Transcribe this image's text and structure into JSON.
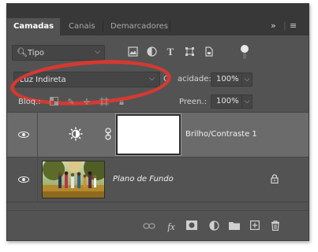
{
  "tabs": [
    {
      "label": "Camadas",
      "active": true
    },
    {
      "label": "Canais",
      "active": false
    },
    {
      "label": "Demarcadores",
      "active": false
    }
  ],
  "tabbar_controls": {
    "collapse": "»",
    "menu": "≡"
  },
  "filter": {
    "icon": "search-icon",
    "value": "Tipo"
  },
  "filter_icons": [
    "image-icon",
    "adjustment-circle-icon",
    "type-T-icon",
    "transform-icon",
    "smart-object-icon"
  ],
  "blend_mode": {
    "value": "Luz Indireta"
  },
  "opacity": {
    "label": "Opacidade:",
    "label_partial_visible": "acidade:",
    "value": "100%"
  },
  "lock": {
    "label": "Bloq.:",
    "icons": [
      "lock-pixels-icon",
      "lock-paint-icon",
      "lock-position-icon",
      "lock-artboard-icon",
      "lock-all-icon"
    ]
  },
  "fill": {
    "label": "Preen.:",
    "value": "100%"
  },
  "layers": [
    {
      "name": "Brilho/Contraste 1",
      "type": "adjustment",
      "visible": true,
      "selected": true
    },
    {
      "name": "Plano de Fundo",
      "type": "image",
      "visible": true,
      "selected": false,
      "locked": true
    }
  ],
  "bottom_icons": [
    "link-icon",
    "fx-icon",
    "add-mask-icon",
    "adjustment-layer-icon",
    "folder-icon",
    "new-layer-icon",
    "trash-icon"
  ],
  "bottom_fx_label": "fx",
  "colors": {
    "panel_bg": "#535353",
    "tabbar_bg": "#383838",
    "selected_layer": "#6b6b6b",
    "annotation_ring": "#d33a32"
  }
}
